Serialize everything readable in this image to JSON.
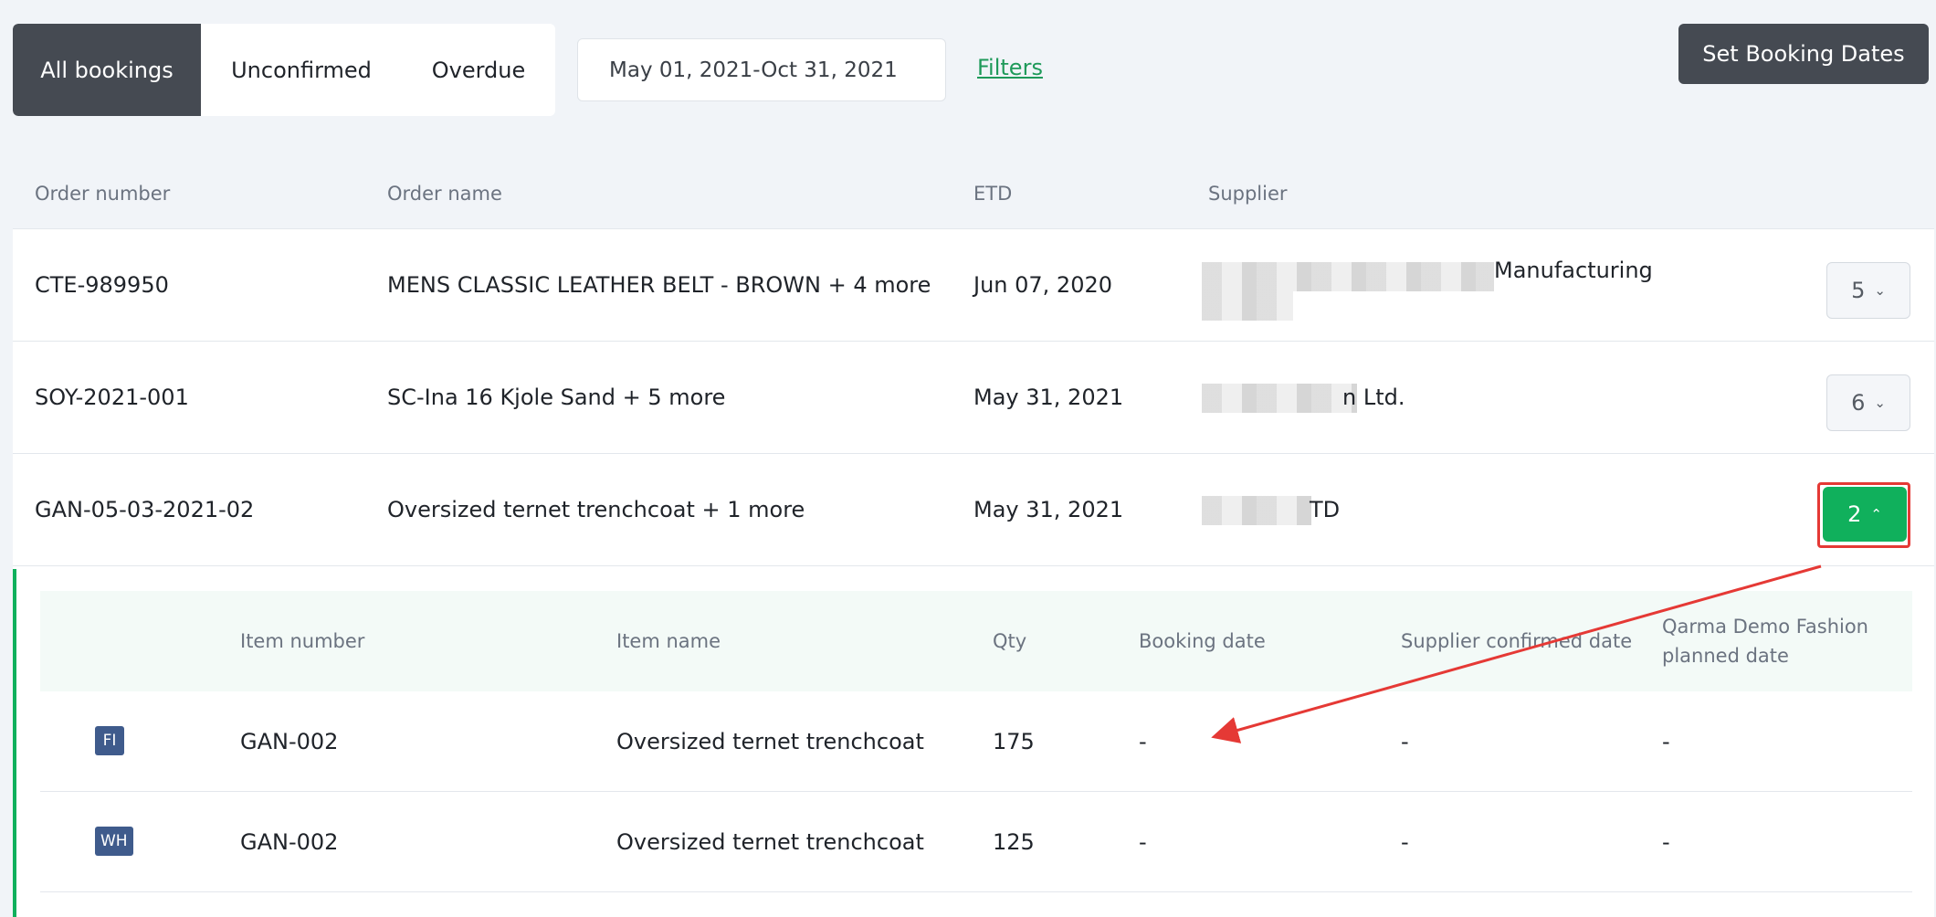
{
  "tabs": [
    {
      "label": "All bookings",
      "active": true
    },
    {
      "label": "Unconfirmed",
      "active": false
    },
    {
      "label": "Overdue",
      "active": false
    }
  ],
  "date_range": "May 01, 2021-Oct 31, 2021",
  "filters_label": "Filters",
  "set_dates_label": "Set Booking Dates",
  "columns": {
    "order_number": "Order number",
    "order_name": "Order name",
    "etd": "ETD",
    "supplier": "Supplier"
  },
  "orders": [
    {
      "number": "CTE-989950",
      "name": "MENS CLASSIC LEATHER BELT - BROWN + 4 more",
      "etd": "Jun 07, 2020",
      "supplier_visible": "Manufacturing",
      "count": "5",
      "expanded": false
    },
    {
      "number": "SOY-2021-001",
      "name": "SC-Ina 16 Kjole Sand + 5 more",
      "etd": "May 31, 2021",
      "supplier_visible": "n Ltd.",
      "count": "6",
      "expanded": false
    },
    {
      "number": "GAN-05-03-2021-02",
      "name": "Oversized ternet trenchcoat + 1 more",
      "etd": "May 31, 2021",
      "supplier_visible": "TD",
      "count": "2",
      "expanded": true
    }
  ],
  "sub_columns": {
    "item_number": "Item number",
    "item_name": "Item name",
    "qty": "Qty",
    "booking_date": "Booking date",
    "supplier_confirmed": "Supplier confirmed date",
    "planned_line1": "Qarma Demo Fashion",
    "planned_line2": "planned date"
  },
  "items": [
    {
      "badge": "FI",
      "number": "GAN-002",
      "name": "Oversized ternet trenchcoat",
      "qty": "175",
      "booking_date": "-",
      "supplier_confirmed": "-",
      "planned": "-"
    },
    {
      "badge": "WH",
      "number": "GAN-002",
      "name": "Oversized ternet trenchcoat",
      "qty": "125",
      "booking_date": "-",
      "supplier_confirmed": "-",
      "planned": "-"
    }
  ],
  "colors": {
    "accent_green": "#10b05c",
    "dark_button": "#454a52",
    "annotation_red": "#e53935",
    "badge_blue": "#3f5b8c"
  }
}
